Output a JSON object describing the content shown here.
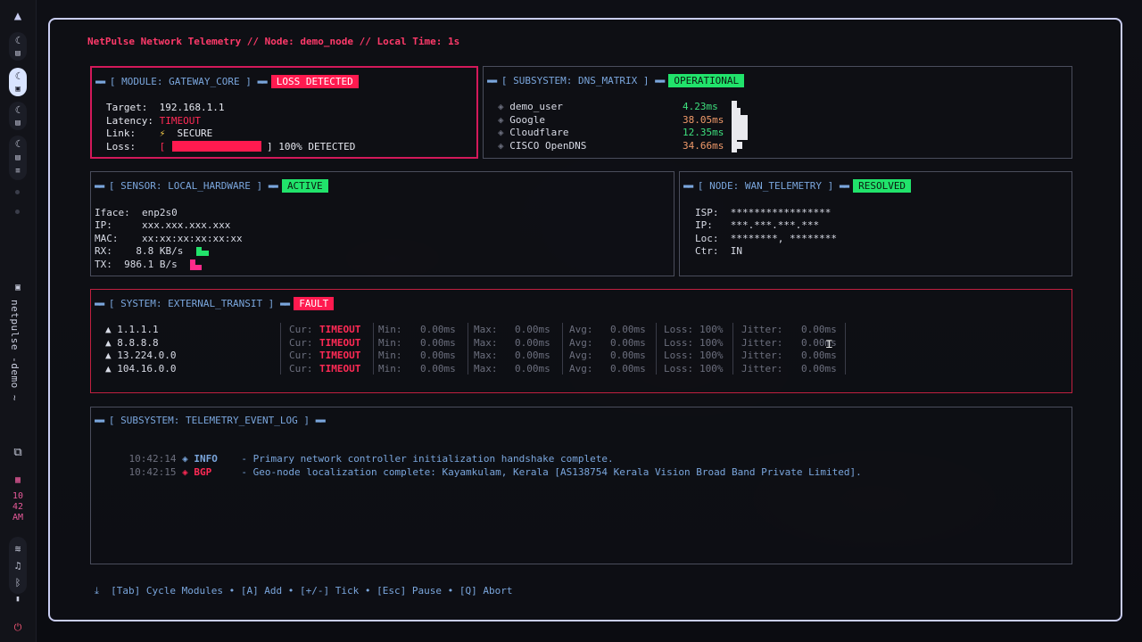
{
  "dock": {
    "workspace_name": "netpulse -demo ~",
    "clock": {
      "hour": "10",
      "minute": "42",
      "ampm": "AM"
    }
  },
  "header": "NetPulse Network Telemetry // Node: demo_node // Local Time: 1s",
  "gateway": {
    "title": "[ MODULE: GATEWAY_CORE ]",
    "badge": "LOSS DETECTED",
    "rows": [
      {
        "label": "Target:",
        "value": "192.168.1.1"
      },
      {
        "label": "Latency:",
        "value": "TIMEOUT"
      },
      {
        "label": "Link:",
        "value": "SECURE"
      },
      {
        "label": "Loss:",
        "value": "100% DETECTED"
      }
    ],
    "loss_fraction": 1.0
  },
  "dns": {
    "title": "[ SUBSYSTEM: DNS_MATRIX ]",
    "badge": "OPERATIONAL",
    "servers": [
      {
        "name": "demo_user",
        "latency": "4.23ms"
      },
      {
        "name": "Google",
        "latency": "38.05ms"
      },
      {
        "name": "Cloudflare",
        "latency": "12.35ms"
      },
      {
        "name": "CISCO OpenDNS",
        "latency": "34.66ms"
      }
    ]
  },
  "sensor": {
    "title": "[ SENSOR: LOCAL_HARDWARE ]",
    "badge": "ACTIVE",
    "rows": [
      {
        "label": "Iface:",
        "value": "enp2s0"
      },
      {
        "label": "IP:",
        "value": "xxx.xxx.xxx.xxx"
      },
      {
        "label": "MAC:",
        "value": "xx:xx:xx:xx:xx:xx"
      },
      {
        "label": "RX:",
        "value": "8.8 KB/s"
      },
      {
        "label": "TX:",
        "value": "986.1 B/s"
      }
    ]
  },
  "wan": {
    "title": "[ NODE: WAN_TELEMETRY ]",
    "badge": "RESOLVED",
    "rows": [
      {
        "label": "ISP:",
        "value": "*****************"
      },
      {
        "label": "IP:",
        "value": "***.***.***.***"
      },
      {
        "label": "Loc:",
        "value": "********, ********"
      },
      {
        "label": "Ctr:",
        "value": "IN"
      }
    ]
  },
  "transit": {
    "title": "[ SYSTEM: EXTERNAL_TRANSIT ]",
    "badge": "FAULT",
    "labels": {
      "cur": "Cur:",
      "min": "Min:",
      "max": "Max:",
      "avg": "Avg:",
      "loss": "Loss:",
      "jitter": "Jitter:"
    },
    "hosts": [
      {
        "host": "1.1.1.1",
        "cur": "TIMEOUT",
        "min": "0.00ms",
        "max": "0.00ms",
        "avg": "0.00ms",
        "loss": "100%",
        "jitter": "0.00ms"
      },
      {
        "host": "8.8.8.8",
        "cur": "TIMEOUT",
        "min": "0.00ms",
        "max": "0.00ms",
        "avg": "0.00ms",
        "loss": "100%",
        "jitter": "0.00ms"
      },
      {
        "host": "13.224.0.0",
        "cur": "TIMEOUT",
        "min": "0.00ms",
        "max": "0.00ms",
        "avg": "0.00ms",
        "loss": "100%",
        "jitter": "0.00ms"
      },
      {
        "host": "104.16.0.0",
        "cur": "TIMEOUT",
        "min": "0.00ms",
        "max": "0.00ms",
        "avg": "0.00ms",
        "loss": "100%",
        "jitter": "0.00ms"
      }
    ]
  },
  "eventlog": {
    "title": "[ SUBSYSTEM: TELEMETRY_EVENT_LOG ]",
    "events": [
      {
        "time": "10:42:14",
        "level": "INFO",
        "message": "- Primary network controller initialization handshake complete."
      },
      {
        "time": "10:42:15",
        "level": "BGP",
        "message": "- Geo-node localization complete: Kayamkulam, Kerala [AS138754 Kerala Vision Broad Band Private Limited]."
      }
    ]
  },
  "footer": "[Tab] Cycle Modules • [A] Add • [+/-] Tick • [Esc] Pause • [Q] Abort"
}
